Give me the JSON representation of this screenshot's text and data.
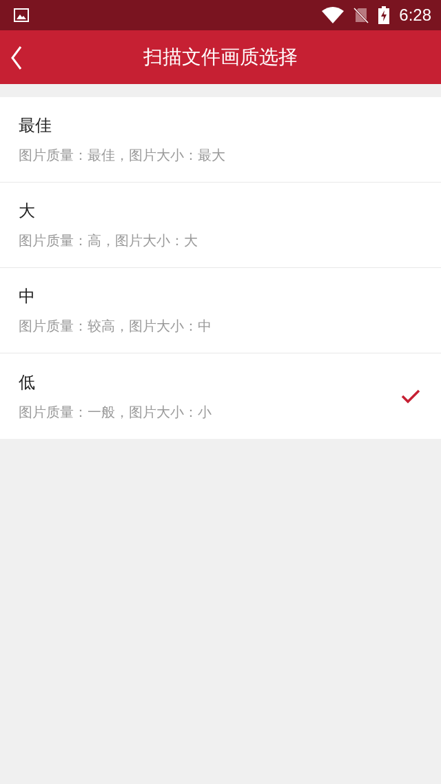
{
  "status_bar": {
    "time": "6:28"
  },
  "header": {
    "title": "扫描文件画质选择"
  },
  "options": [
    {
      "title": "最佳",
      "description": "图片质量：最佳，图片大小：最大",
      "selected": false
    },
    {
      "title": "大",
      "description": "图片质量：高，图片大小：大",
      "selected": false
    },
    {
      "title": "中",
      "description": "图片质量：较高，图片大小：中",
      "selected": false
    },
    {
      "title": "低",
      "description": "图片质量：一般，图片大小：小",
      "selected": true
    }
  ]
}
